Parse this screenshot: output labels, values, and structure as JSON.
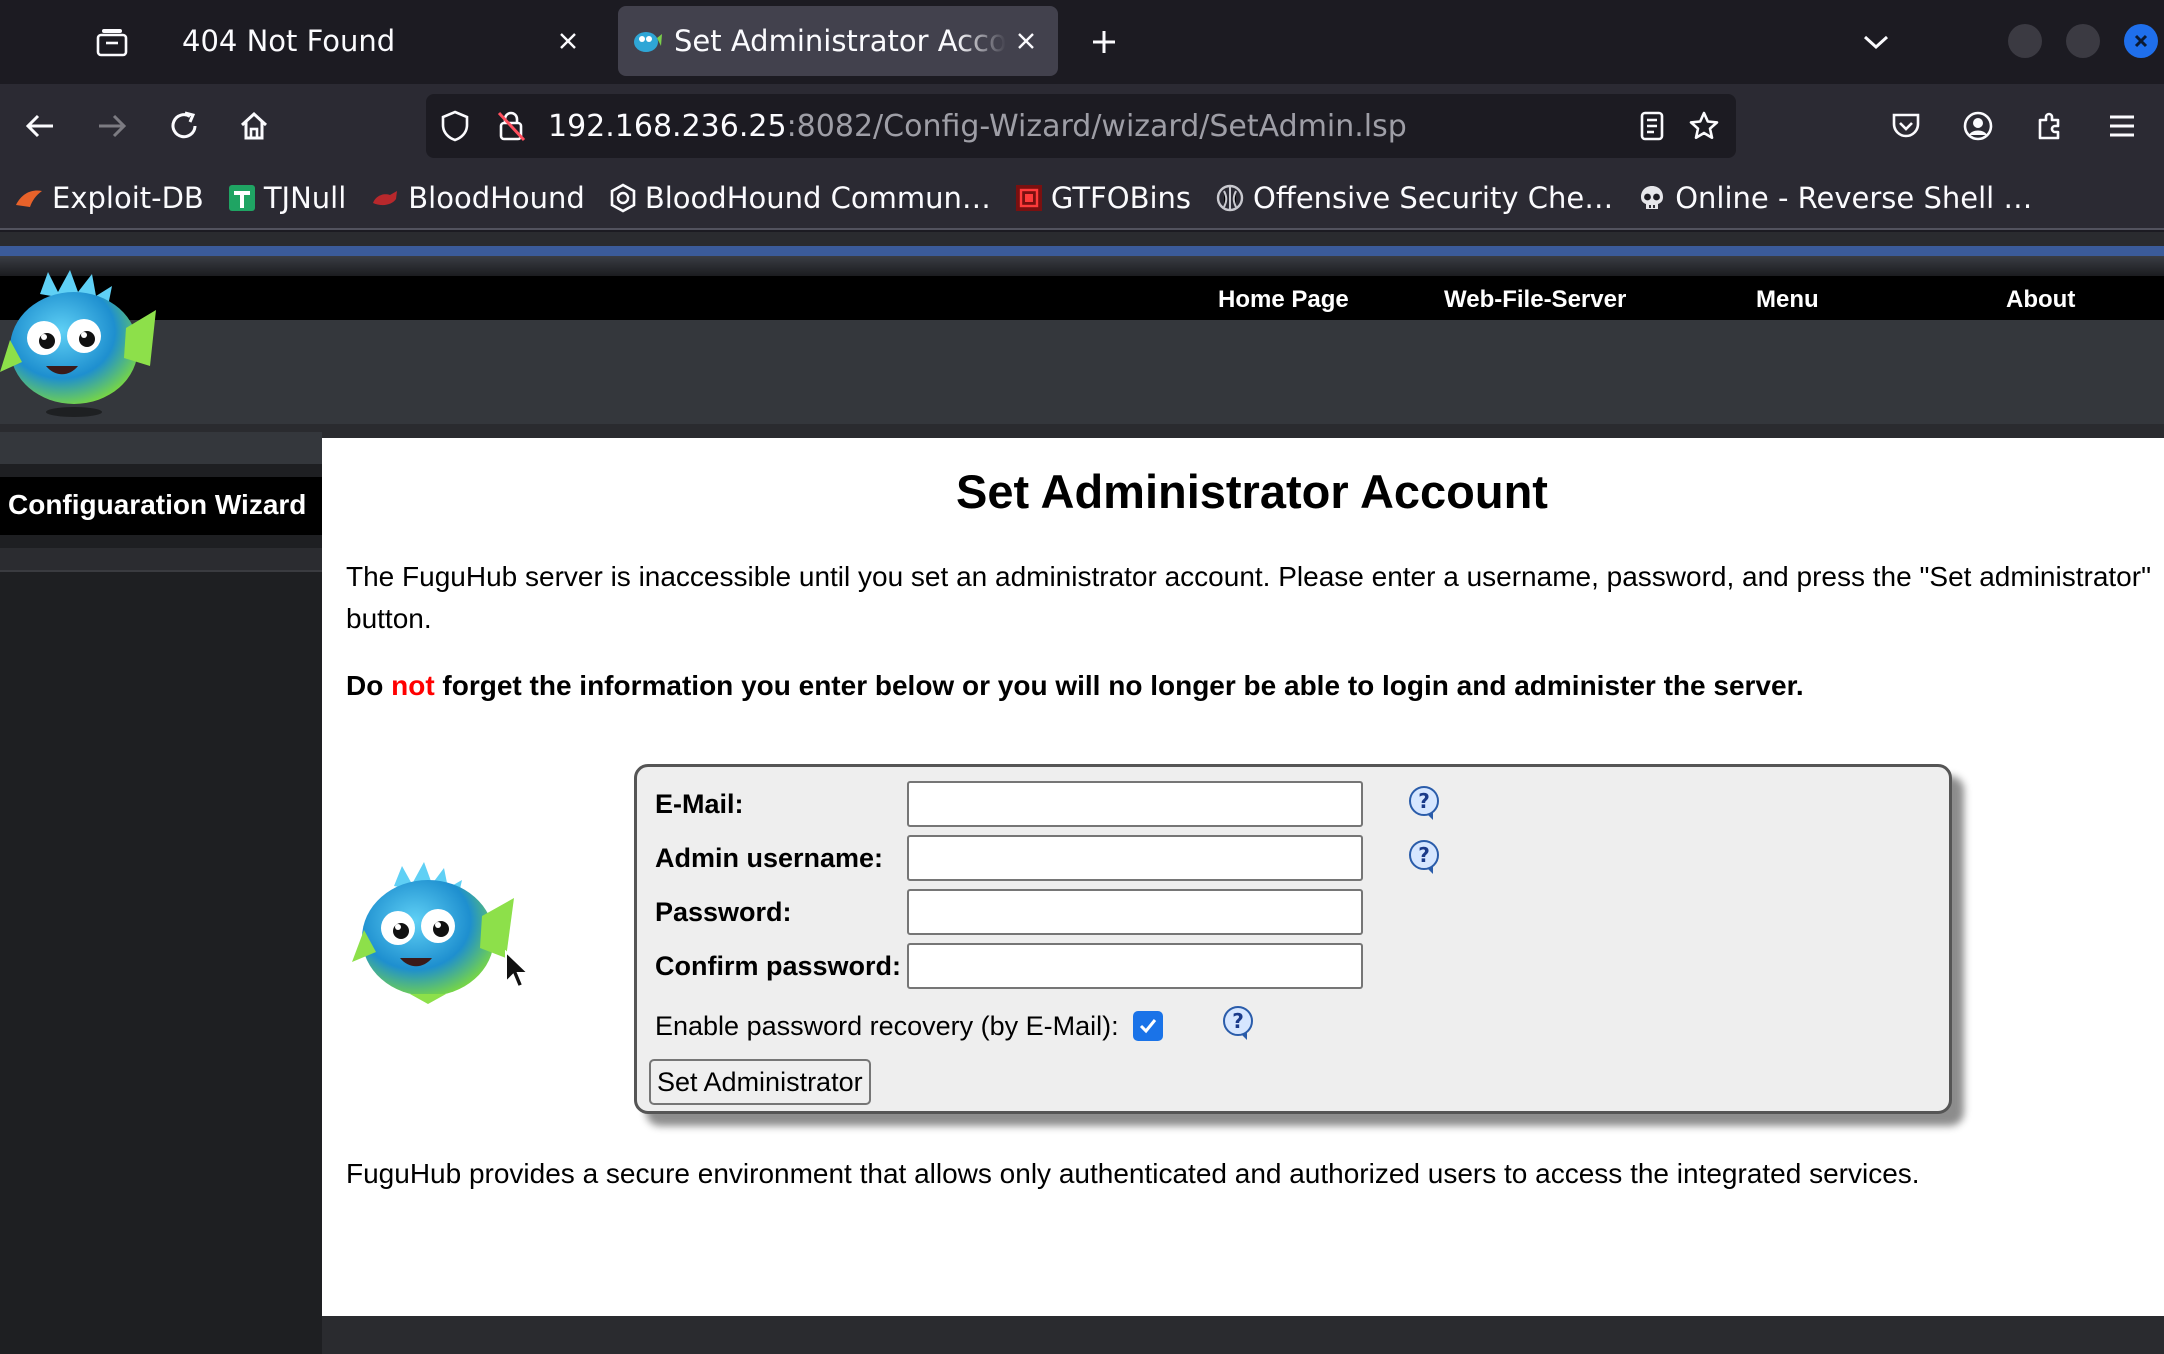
{
  "browser": {
    "tabs": [
      {
        "title": "404 Not Found",
        "active": false
      },
      {
        "title": "Set Administrator Account",
        "active": true
      }
    ],
    "url_host": "192.168.236.25",
    "url_path": ":8082/Config-Wizard/wizard/SetAdmin.lsp",
    "accent": "#1f6feb"
  },
  "bookmarks": [
    {
      "label": "Exploit-DB",
      "icon": "exploit-db-icon"
    },
    {
      "label": "TJNull",
      "icon": "tjnull-icon"
    },
    {
      "label": "BloodHound",
      "icon": "bloodhound-icon"
    },
    {
      "label": "BloodHound Commun…",
      "icon": "hexagon-icon"
    },
    {
      "label": "GTFOBins",
      "icon": "gtfobins-icon"
    },
    {
      "label": "Offensive Security Che…",
      "icon": "offsec-icon"
    },
    {
      "label": "Online - Reverse Shell …",
      "icon": "skull-icon"
    }
  ],
  "site_menu": {
    "home": "Home Page",
    "web_file_server": "Web-File-Server",
    "menu": "Menu",
    "about": "About"
  },
  "sidebar": {
    "title": "Configuaration Wizard"
  },
  "main": {
    "title": "Set Administrator Account",
    "intro": "The FuguHub server is inaccessible until you set an administrator account. Please enter a username, password, and press the \"Set administrator\" button.",
    "warning_pre": "Do ",
    "warning_red": "not",
    "warning_post": " forget the information you enter below or you will no longer be able to login and administer the server.",
    "footer": "FuguHub provides a secure environment that allows only authenticated and authorized users to access the integrated services."
  },
  "form": {
    "email_label": "E-Mail:",
    "email_value": "",
    "username_label": "Admin username:",
    "username_value": "",
    "password_label": "Password:",
    "password_value": "",
    "confirm_label": "Confirm password:",
    "confirm_value": "",
    "recovery_label": "Enable password recovery (by E-Mail):",
    "recovery_checked": true,
    "submit_label": "Set Administrator"
  },
  "colors": {
    "page_dark": "#2a2b2f",
    "warning_red": "#ff0000",
    "checkbox_blue": "#1a73e8"
  }
}
